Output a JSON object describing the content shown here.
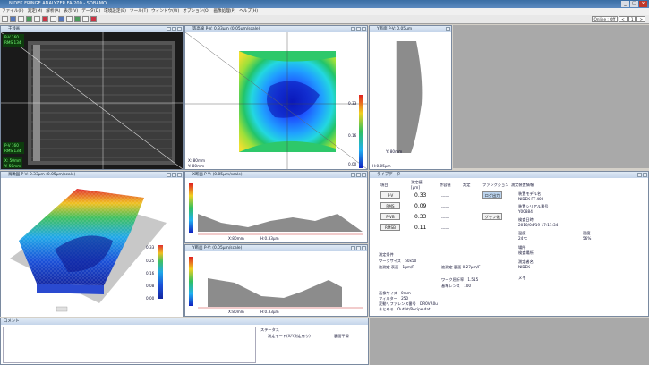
{
  "app": {
    "title": "NIDEK FRINGE ANALYZER FA-200 - SOBAMO",
    "window_controls": [
      "_",
      "□",
      "×"
    ]
  },
  "menu": [
    "ファイル(F)",
    "測定(M)",
    "解析(A)",
    "表示(V)",
    "データ(D)",
    "環境設定(E)",
    "ツール(T)",
    "ウィンドウ(W)",
    "オプション(O)",
    "画像処理(P)",
    "ヘルプ(H)"
  ],
  "toolbar": {
    "online_label": "Online : Off",
    "page_indicator": "1",
    "prev_label": "<",
    "next_label": ">"
  },
  "panels": {
    "interferogram": {
      "title": "干渉画",
      "pv_label": "P-V",
      "pv_value": "160",
      "rms_label": "RMS",
      "rms_value": "134",
      "bottom_pv": "P-V 160",
      "bottom_rms": "RMS 134",
      "x_label": "X: 50mm",
      "y_label": "Y: 50mm"
    },
    "contour": {
      "title": "等高線 P-V: 0.33μm (0.05μm/scale)",
      "x_label": "X:  80mm",
      "y_label": "Y:  80mm",
      "scale_labels": [
        "0.33",
        "0.16",
        "0.00"
      ]
    },
    "section": {
      "title": "Y断面 P-V: 0.05μm",
      "x_label": "Y:  80mm",
      "y_label": "H:0.05μm"
    },
    "view3d": {
      "title": "鳥瞰図 P-V: 0.33μm (0.05μm/scale)",
      "scale_labels": [
        "0.33",
        "0.25",
        "0.16",
        "0.08",
        "0.00"
      ]
    },
    "xsec1": {
      "title": "X断面 P-V: (0.05μm/scale)",
      "axis_labels": [
        "X:80mm",
        "H:0.33μm"
      ]
    },
    "xsec2": {
      "title": "Y断面 P-V: (0.05μm/scale)",
      "axis_labels": [
        "X:80mm",
        "H:0.33μm"
      ]
    },
    "results": {
      "title": "ライブデータ",
      "header": {
        "item": "項目",
        "measured": "測定値",
        "unit": "[μm]",
        "tol": "許容値",
        "judge": "判定",
        "func": "ファンクション"
      },
      "rows": [
        {
          "label": "P-V",
          "value": "0.33",
          "tol": "------"
        },
        {
          "label": "RMS",
          "value": "0.09",
          "tol": "------"
        },
        {
          "label": "P-VB",
          "value": "0.33",
          "tol": "------"
        },
        {
          "label": "RMSB",
          "value": "0.11",
          "tol": "------"
        }
      ],
      "side_buttons": [
        "ログ出力",
        "グラフ化"
      ],
      "cond_title": "測定条件",
      "conditions": [
        {
          "k": "ワークサイズ",
          "v": "50x50"
        },
        {
          "k": "被測定 表面",
          "v": "1μm/F"
        },
        {
          "k": "",
          "v": "被測定 裏面 0.27μm/F"
        },
        {
          "k": "ワーク屈折率",
          "v": "1.515"
        },
        {
          "k": "基準レンズ",
          "v": "100"
        }
      ],
      "extra": [
        {
          "k": "画像サイズ",
          "v": "0mm"
        },
        {
          "k": "フィルター",
          "v": "250"
        },
        {
          "k": "変動リファレンス番号",
          "v": "DR0VR0u"
        },
        {
          "k": "まとめる",
          "v": "Outlet/Recipe.dat"
        }
      ],
      "close_button": "閉じる"
    },
    "info": {
      "title": "測定装置情報",
      "model_label": "装置モデル名",
      "model": "NIDEK FT-400",
      "serial_label": "装置シリアル番号",
      "serial": "Y00884",
      "date_label": "検査日時",
      "date": "2010/04/19 17:11:34",
      "temp_label": "温度",
      "temp": "24℃",
      "hum_label": "湿度",
      "hum": "56%",
      "place_label": "場所",
      "place": "検査場所",
      "operator_label": "測定者名",
      "operator": "NIDEK",
      "memo_label": "メモ"
    },
    "comment": {
      "title": "コメント",
      "status_title": "ステータス",
      "status_line": "測定モード(X/Y測定有り)",
      "status_right": "裏面平滑"
    }
  },
  "colors": {
    "accent": "#3a6ea5",
    "panel_border": "#7a8aa0"
  }
}
